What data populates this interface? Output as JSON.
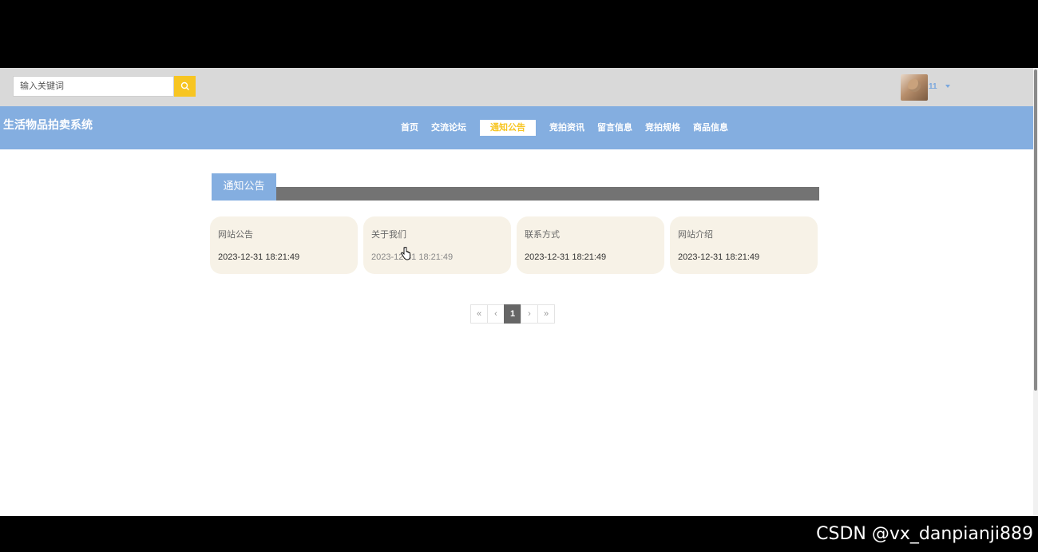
{
  "search": {
    "placeholder": "输入关键词"
  },
  "user": {
    "name": "11"
  },
  "site": {
    "title": "生活物品拍卖系统"
  },
  "nav": [
    {
      "label": "首页",
      "active": false
    },
    {
      "label": "交流论坛",
      "active": false
    },
    {
      "label": "通知公告",
      "active": true
    },
    {
      "label": "竞拍资讯",
      "active": false
    },
    {
      "label": "留言信息",
      "active": false
    },
    {
      "label": "竞拍规格",
      "active": false
    },
    {
      "label": "商品信息",
      "active": false
    }
  ],
  "section": {
    "title": "通知公告"
  },
  "cards": [
    {
      "title": "网站公告",
      "date": "2023-12-31 18:21:49"
    },
    {
      "title": "关于我们",
      "date": "2023-12-31 18:21:49"
    },
    {
      "title": "联系方式",
      "date": "2023-12-31 18:21:49"
    },
    {
      "title": "网站介绍",
      "date": "2023-12-31 18:21:49"
    }
  ],
  "pagination": {
    "first": "«",
    "prev": "‹",
    "current": "1",
    "next": "›",
    "last": "»"
  },
  "watermark": "CSDN @vx_danpianji889",
  "colors": {
    "accent": "#84aee0",
    "highlight": "#f7c522",
    "card_bg": "#f7f2e7"
  }
}
